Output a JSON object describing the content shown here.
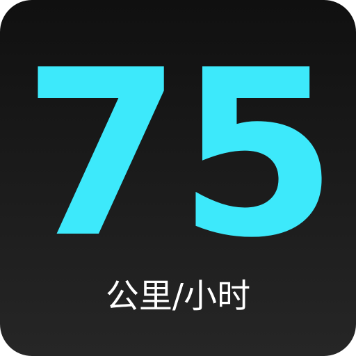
{
  "speedometer": {
    "value": "75",
    "unit": "公里/小时"
  },
  "colors": {
    "value_color": "#3de9fb",
    "unit_color": "#ffffff",
    "background_top": "#101010",
    "background_bottom": "#262626"
  }
}
